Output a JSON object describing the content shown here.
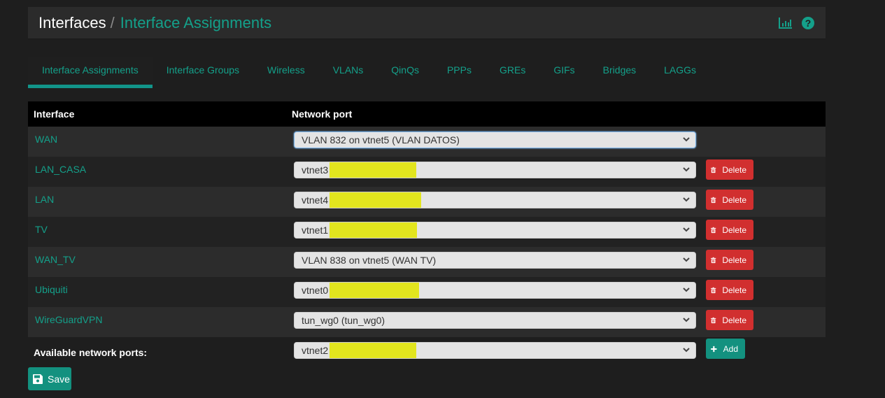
{
  "header": {
    "breadcrumb_root": "Interfaces",
    "breadcrumb_sep": "/",
    "breadcrumb_current": "Interface Assignments",
    "icons": [
      "chart-icon",
      "help-icon"
    ],
    "help_glyph": "?"
  },
  "tabs": [
    {
      "label": "Interface Assignments",
      "active": true
    },
    {
      "label": "Interface Groups",
      "active": false
    },
    {
      "label": "Wireless",
      "active": false
    },
    {
      "label": "VLANs",
      "active": false
    },
    {
      "label": "QinQs",
      "active": false
    },
    {
      "label": "PPPs",
      "active": false
    },
    {
      "label": "GREs",
      "active": false
    },
    {
      "label": "GIFs",
      "active": false
    },
    {
      "label": "Bridges",
      "active": false
    },
    {
      "label": "LAGGs",
      "active": false
    }
  ],
  "table": {
    "headers": {
      "interface": "Interface",
      "network_port": "Network port"
    },
    "rows": [
      {
        "interface": "WAN",
        "port": "VLAN 832 on vtnet5 (VLAN DATOS)",
        "redacted": false,
        "deletable": false
      },
      {
        "interface": "LAN_CASA",
        "port": "vtnet3",
        "redacted": true,
        "deletable": true
      },
      {
        "interface": "LAN",
        "port": "vtnet4",
        "redacted": true,
        "deletable": true
      },
      {
        "interface": "TV",
        "port": "vtnet1",
        "redacted": true,
        "deletable": true
      },
      {
        "interface": "WAN_TV",
        "port": "VLAN 838 on vtnet5 (WAN TV)",
        "redacted": false,
        "deletable": true
      },
      {
        "interface": "Ubiquiti",
        "port": "vtnet0",
        "redacted": true,
        "deletable": true
      },
      {
        "interface": "WireGuardVPN",
        "port": "tun_wg0 (tun_wg0)",
        "redacted": false,
        "deletable": true
      }
    ],
    "delete_label": "Delete",
    "available": {
      "label": "Available network ports:",
      "port": "vtnet2",
      "redacted": true,
      "add_label": "Add"
    }
  },
  "save_label": "Save",
  "colors": {
    "accent": "#14a08a",
    "danger": "#d12f2f",
    "redaction": "#e2e51e"
  }
}
